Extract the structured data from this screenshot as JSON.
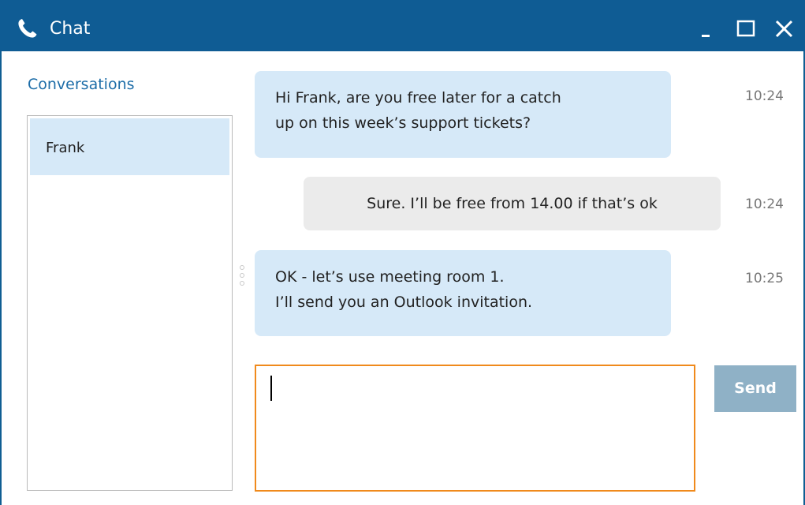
{
  "window": {
    "title": "Chat",
    "title_icon": "phone-icon",
    "controls": {
      "minimize_icon": "minimize-icon",
      "maximize_icon": "maximize-icon",
      "close_icon": "close-icon"
    },
    "colors": {
      "titlebar": "#0f5c94",
      "accent_text": "#1d6da8",
      "incoming_bubble": "#d6e9f8",
      "outgoing_bubble": "#ebebeb",
      "compose_focus_border": "#f08a1c",
      "send_button": "#8fb1c6"
    }
  },
  "sidebar": {
    "header": "Conversations",
    "items": [
      {
        "label": "Frank",
        "selected": true
      }
    ]
  },
  "messages": [
    {
      "direction": "incoming",
      "lines": [
        "Hi Frank, are you free later for a catch",
        "up on this week’s support tickets?"
      ],
      "time": "10:24"
    },
    {
      "direction": "outgoing",
      "lines": [
        "Sure. I’ll be free from 14.00 if that’s ok"
      ],
      "time": "10:24"
    },
    {
      "direction": "incoming",
      "lines": [
        "OK - let’s use meeting room 1.",
        "I’ll send you an Outlook invitation."
      ],
      "time": "10:25"
    }
  ],
  "compose": {
    "value": "",
    "send_label": "Send"
  }
}
